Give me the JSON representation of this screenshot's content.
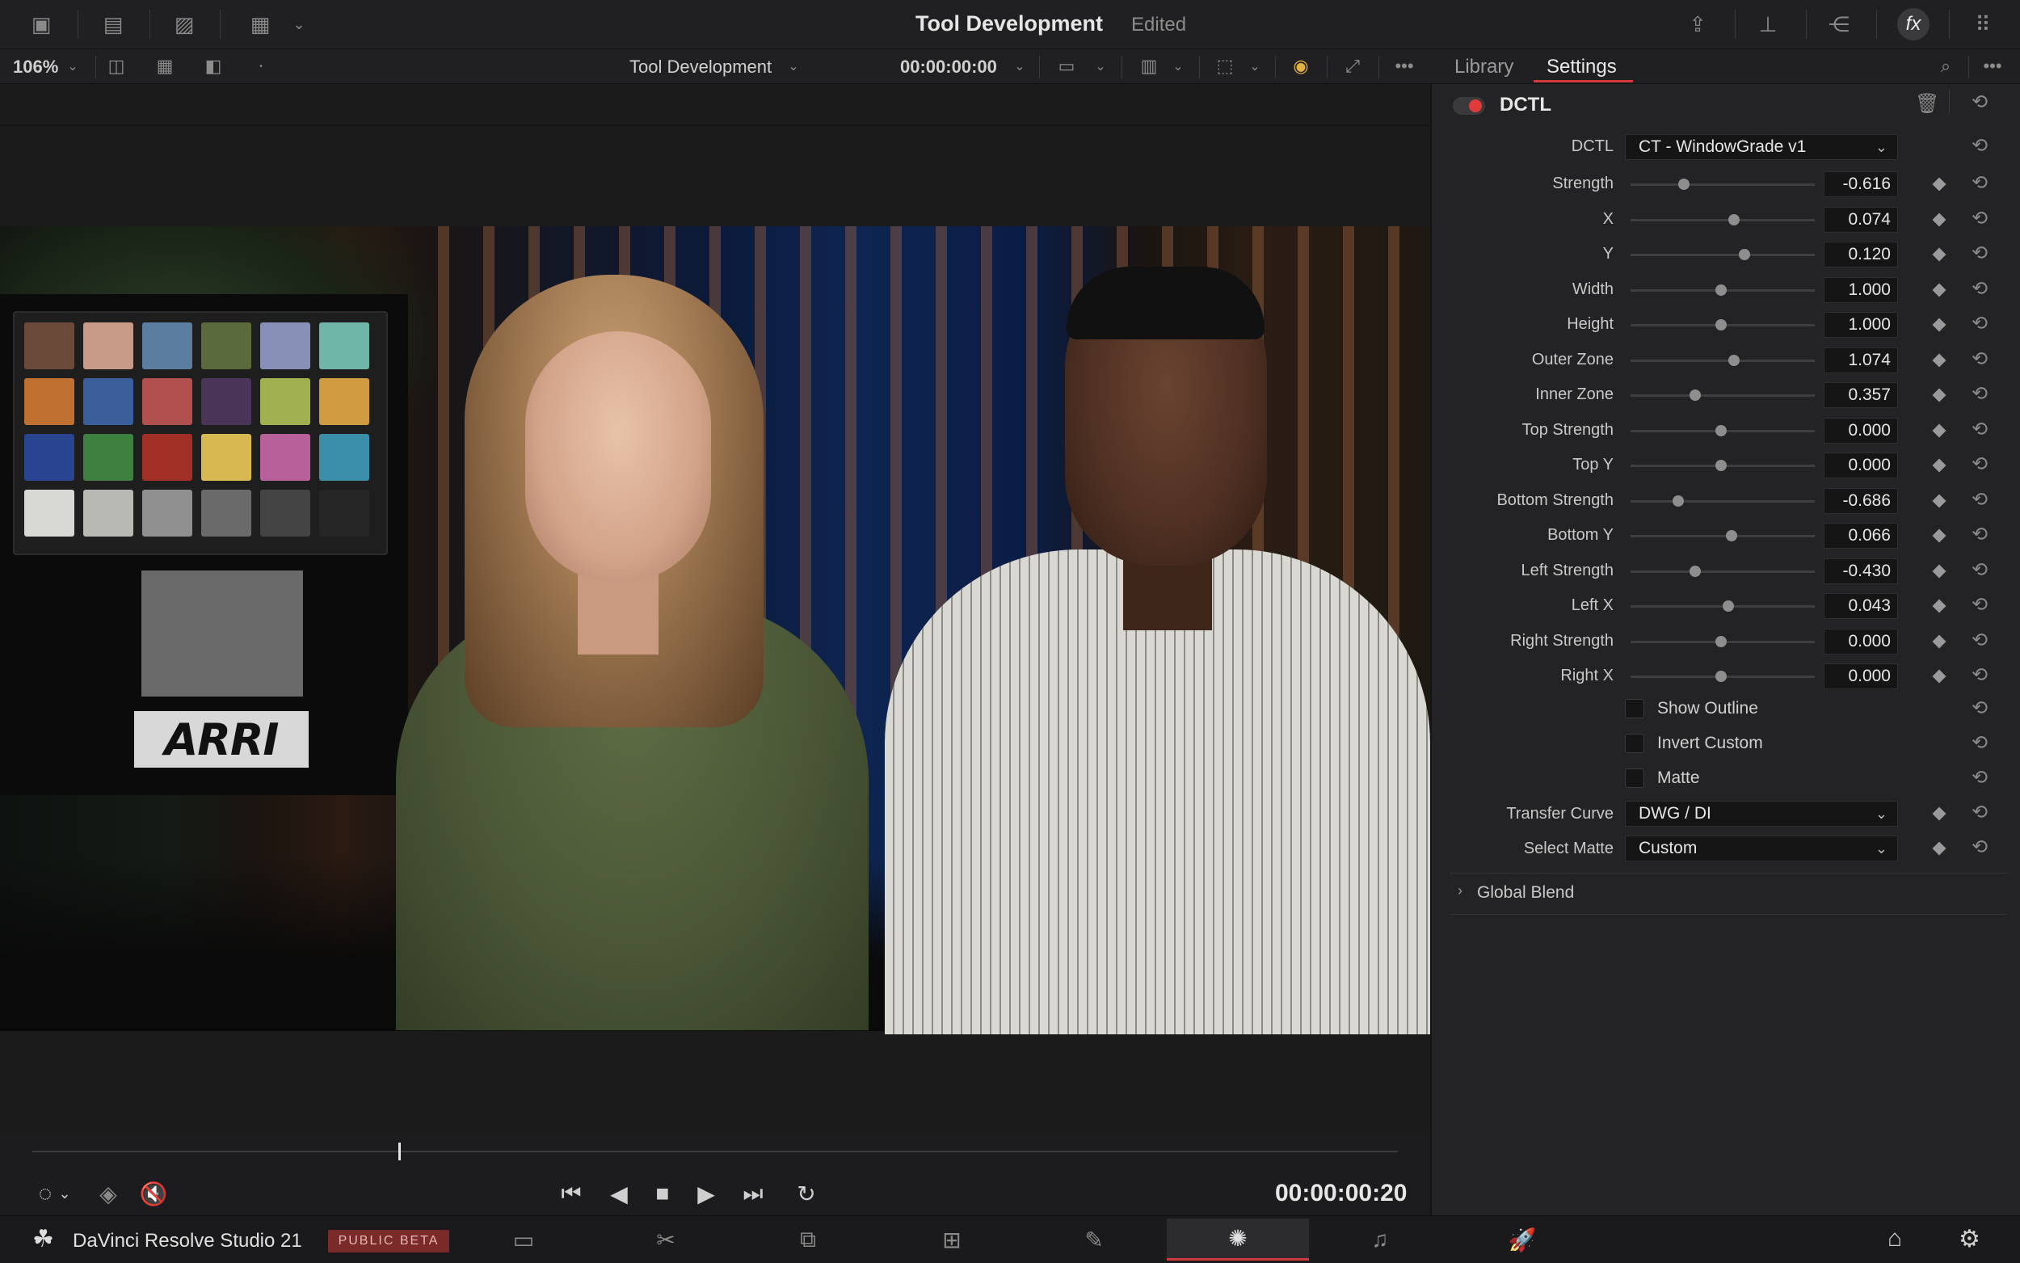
{
  "window": {
    "title": "Tool Development",
    "status": "Edited"
  },
  "viewer_toolbar": {
    "zoom": "106%",
    "timeline_name": "Tool Development",
    "timecode": "00:00:00:00"
  },
  "panel": {
    "tabs": [
      {
        "label": "Library",
        "active": false
      },
      {
        "label": "Settings",
        "active": true
      }
    ],
    "effect_name": "DCTL",
    "dctl_label": "DCTL",
    "dctl_value": "CT - WindowGrade v1",
    "params": [
      {
        "label": "Strength",
        "value": "-0.616",
        "pos": 0.29
      },
      {
        "label": "X",
        "value": "0.074",
        "pos": 0.56
      },
      {
        "label": "Y",
        "value": "0.120",
        "pos": 0.62
      },
      {
        "label": "Width",
        "value": "1.000",
        "pos": 0.49
      },
      {
        "label": "Height",
        "value": "1.000",
        "pos": 0.49
      },
      {
        "label": "Outer Zone",
        "value": "1.074",
        "pos": 0.56
      },
      {
        "label": "Inner Zone",
        "value": "0.357",
        "pos": 0.35
      },
      {
        "label": "Top Strength",
        "value": "0.000",
        "pos": 0.49
      },
      {
        "label": "Top Y",
        "value": "0.000",
        "pos": 0.49
      },
      {
        "label": "Bottom Strength",
        "value": "-0.686",
        "pos": 0.26
      },
      {
        "label": "Bottom Y",
        "value": "0.066",
        "pos": 0.55
      },
      {
        "label": "Left Strength",
        "value": "-0.430",
        "pos": 0.35
      },
      {
        "label": "Left X",
        "value": "0.043",
        "pos": 0.53
      },
      {
        "label": "Right Strength",
        "value": "0.000",
        "pos": 0.49
      },
      {
        "label": "Right X",
        "value": "0.000",
        "pos": 0.49
      }
    ],
    "checkboxes": [
      {
        "label": "Show Outline",
        "checked": false
      },
      {
        "label": "Invert Custom",
        "checked": false
      },
      {
        "label": "Matte",
        "checked": false
      }
    ],
    "transfer_curve_label": "Transfer Curve",
    "transfer_curve_value": "DWG / DI",
    "select_matte_label": "Select Matte",
    "select_matte_value": "Custom",
    "global_blend_label": "Global Blend"
  },
  "transport": {
    "timecode": "00:00:00:20"
  },
  "bottom_bar": {
    "app_name": "DaVinci Resolve Studio 21",
    "badge": "PUBLIC BETA"
  },
  "image": {
    "logo_text": "ARRI"
  },
  "colors": {
    "accent": "#d53a3a",
    "panel_bg": "#232325"
  }
}
